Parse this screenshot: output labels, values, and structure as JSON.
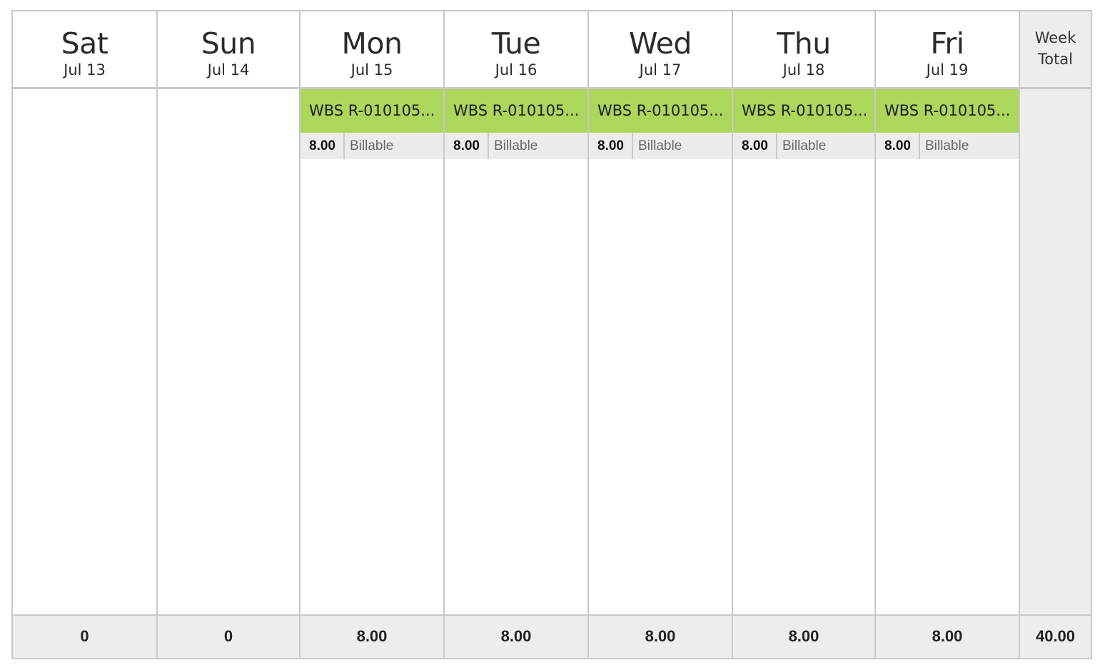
{
  "days": [
    {
      "name": "Sat",
      "date": "Jul 13",
      "total": "0"
    },
    {
      "name": "Sun",
      "date": "Jul 14",
      "total": "0"
    },
    {
      "name": "Mon",
      "date": "Jul 15",
      "total": "8.00",
      "entry": {
        "title": "WBS R-010105...",
        "hours": "8.00",
        "type": "Billable"
      }
    },
    {
      "name": "Tue",
      "date": "Jul 16",
      "total": "8.00",
      "entry": {
        "title": "WBS R-010105...",
        "hours": "8.00",
        "type": "Billable"
      }
    },
    {
      "name": "Wed",
      "date": "Jul 17",
      "total": "8.00",
      "entry": {
        "title": "WBS R-010105...",
        "hours": "8.00",
        "type": "Billable"
      }
    },
    {
      "name": "Thu",
      "date": "Jul 18",
      "total": "8.00",
      "entry": {
        "title": "WBS R-010105...",
        "hours": "8.00",
        "type": "Billable"
      }
    },
    {
      "name": "Fri",
      "date": "Jul 19",
      "total": "8.00",
      "entry": {
        "title": "WBS R-010105...",
        "hours": "8.00",
        "type": "Billable"
      }
    }
  ],
  "week": {
    "label_line1": "Week",
    "label_line2": "Total",
    "total": "40.00"
  },
  "colors": {
    "entry_bg": "#acd65c",
    "footer_bg": "#ededed",
    "border": "#c9c9c9"
  }
}
